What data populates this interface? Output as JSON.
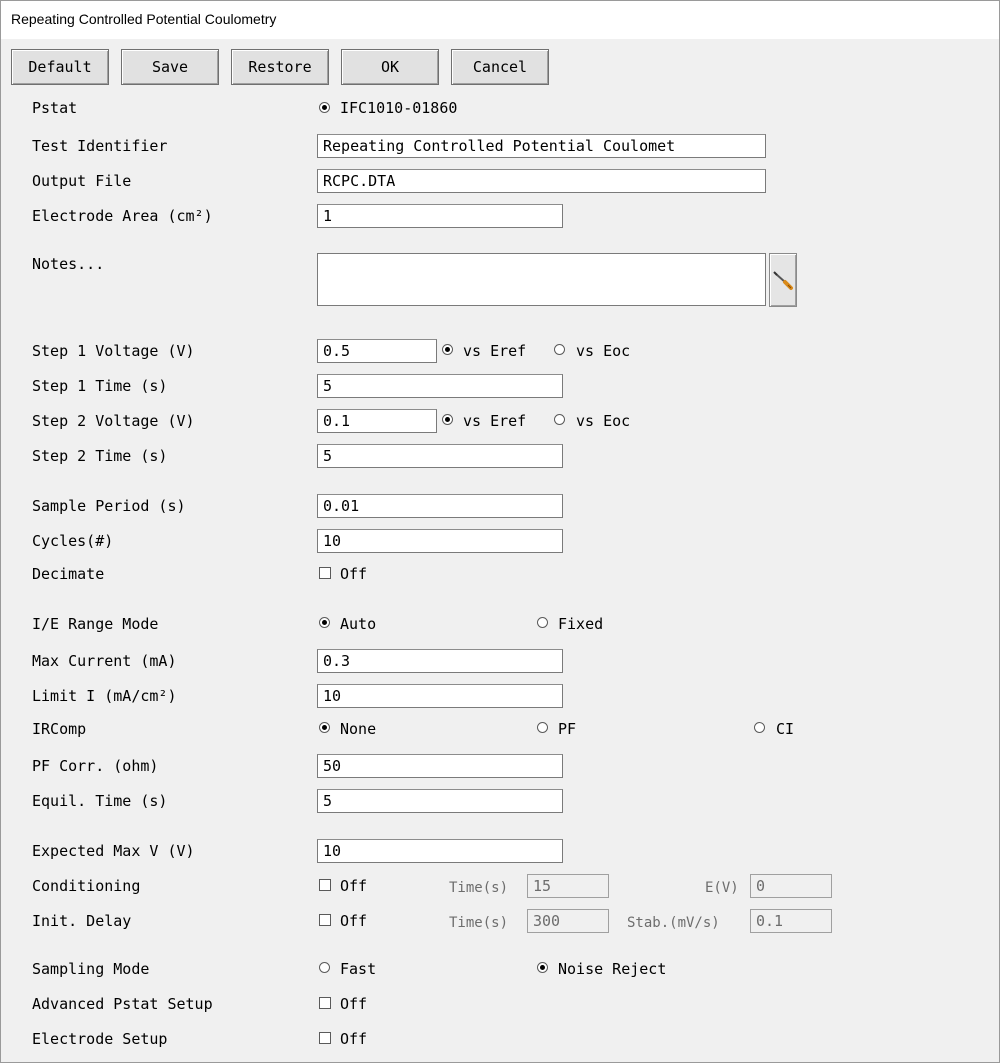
{
  "window": {
    "title": "Repeating Controlled Potential Coulometry"
  },
  "toolbar": {
    "default_label": "Default",
    "save_label": "Save",
    "restore_label": "Restore",
    "ok_label": "OK",
    "cancel_label": "Cancel"
  },
  "pstat": {
    "label": "Pstat",
    "value": "IFC1010-01860"
  },
  "test_identifier": {
    "label": "Test Identifier",
    "value": "Repeating Controlled Potential Coulomet"
  },
  "output_file": {
    "label": "Output File",
    "value": "RCPC.DTA"
  },
  "electrode_area": {
    "label": "Electrode Area (cm²)",
    "value": "1"
  },
  "notes": {
    "label": "Notes...",
    "value": ""
  },
  "step1_voltage": {
    "label": "Step 1 Voltage (V)",
    "value": "0.5",
    "opt1": "vs Eref",
    "opt2": "vs Eoc",
    "selected": "vs Eref"
  },
  "step1_time": {
    "label": "Step 1 Time (s)",
    "value": "5"
  },
  "step2_voltage": {
    "label": "Step 2 Voltage (V)",
    "value": "0.1",
    "opt1": "vs Eref",
    "opt2": "vs Eoc",
    "selected": "vs Eref"
  },
  "step2_time": {
    "label": "Step 2 Time (s)",
    "value": "5"
  },
  "sample_period": {
    "label": "Sample Period (s)",
    "value": "0.01"
  },
  "cycles": {
    "label": "Cycles(#)",
    "value": "10"
  },
  "decimate": {
    "label": "Decimate",
    "check_label": "Off",
    "checked": false
  },
  "ie_range_mode": {
    "label": "I/E Range Mode",
    "opt1": "Auto",
    "opt2": "Fixed",
    "selected": "Auto"
  },
  "max_current": {
    "label": "Max Current (mA)",
    "value": "0.3"
  },
  "limit_i": {
    "label": "Limit I (mA/cm²)",
    "value": "10"
  },
  "ircomp": {
    "label": "IRComp",
    "opt1": "None",
    "opt2": "PF",
    "opt3": "CI",
    "selected": "None"
  },
  "pf_corr": {
    "label": "PF Corr. (ohm)",
    "value": "50"
  },
  "equil_time": {
    "label": "Equil. Time (s)",
    "value": "5"
  },
  "expected_max_v": {
    "label": "Expected Max V (V)",
    "value": "10"
  },
  "conditioning": {
    "label": "Conditioning",
    "check_label": "Off",
    "checked": false,
    "time_label": "Time(s)",
    "time_value": "15",
    "e_label": "E(V)",
    "e_value": "0"
  },
  "init_delay": {
    "label": "Init. Delay",
    "check_label": "Off",
    "checked": false,
    "time_label": "Time(s)",
    "time_value": "300",
    "stab_label": "Stab.(mV/s)",
    "stab_value": "0.1"
  },
  "sampling_mode": {
    "label": "Sampling Mode",
    "opt1": "Fast",
    "opt2": "Noise Reject",
    "selected": "Noise Reject"
  },
  "advanced_pstat": {
    "label": "Advanced Pstat Setup",
    "check_label": "Off",
    "checked": false
  },
  "electrode_setup": {
    "label": "Electrode Setup",
    "check_label": "Off",
    "checked": false
  },
  "colors": {
    "background": "#f0f0f0",
    "field_bg": "#ffffff",
    "disabled_text": "#6d6d6d"
  }
}
